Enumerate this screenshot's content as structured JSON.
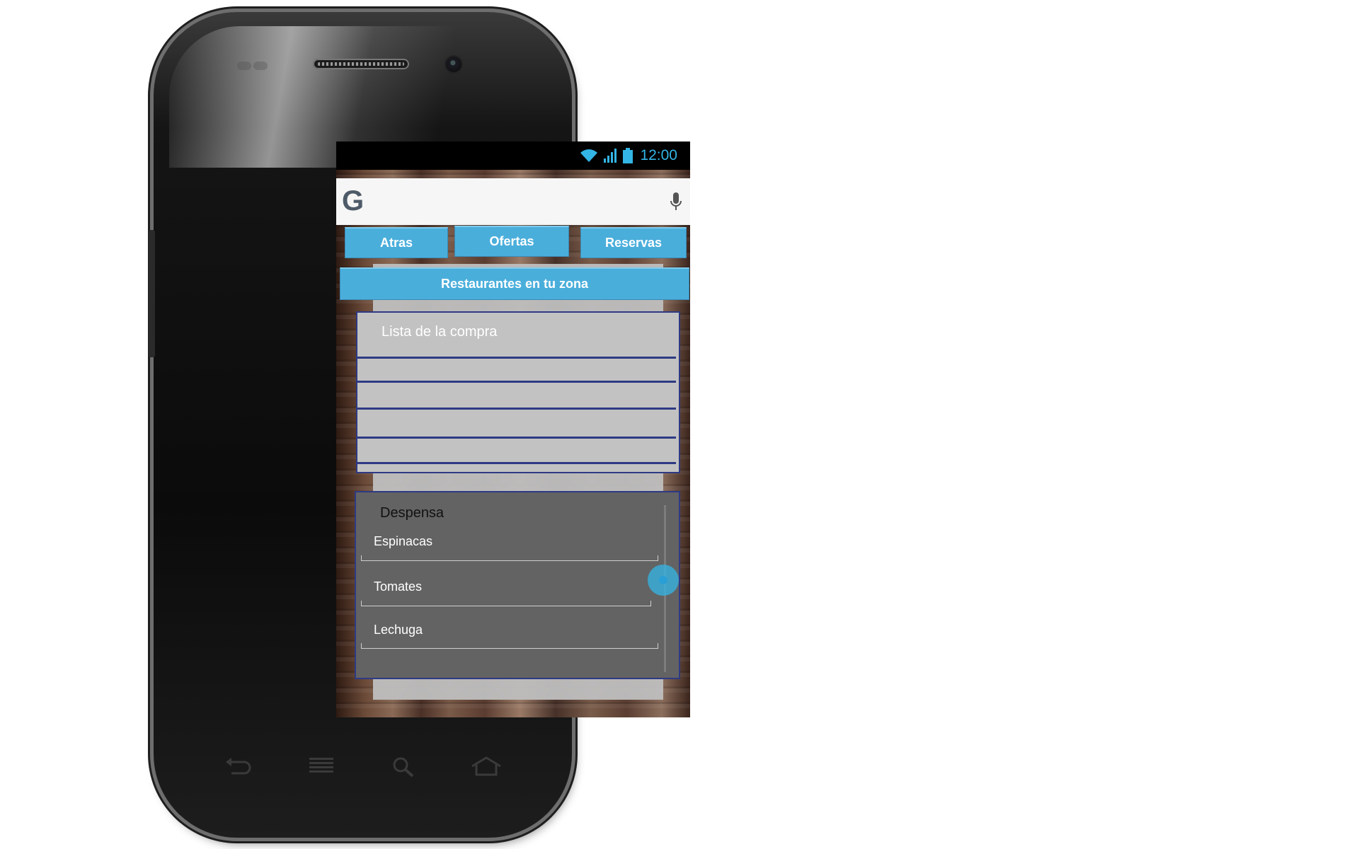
{
  "status_bar": {
    "time": "12:00",
    "icons": [
      "wifi-icon",
      "signal-icon",
      "battery-icon"
    ]
  },
  "search": {
    "logo": "G",
    "icons": [
      "google-logo",
      "microphone-icon"
    ]
  },
  "nav": {
    "back": "Atras",
    "offers": "Ofertas",
    "reservations": "Reservas",
    "nearby": "Restaurantes en tu zona"
  },
  "shopping_list": {
    "title": "Lista de la compra",
    "rows": [
      "",
      "",
      "",
      ""
    ]
  },
  "pantry": {
    "title": "Despensa",
    "items": [
      "Espinacas",
      "Tomates",
      "Lechuga"
    ]
  },
  "hardware_keys": [
    "back-icon",
    "menu-icon",
    "search-icon",
    "home-icon"
  ],
  "colors": {
    "accent": "#33b5e5",
    "button": "#4aaedb",
    "border": "#2e3a84",
    "pantry_bg": "#636363",
    "list_bg": "#c2c2c2"
  }
}
